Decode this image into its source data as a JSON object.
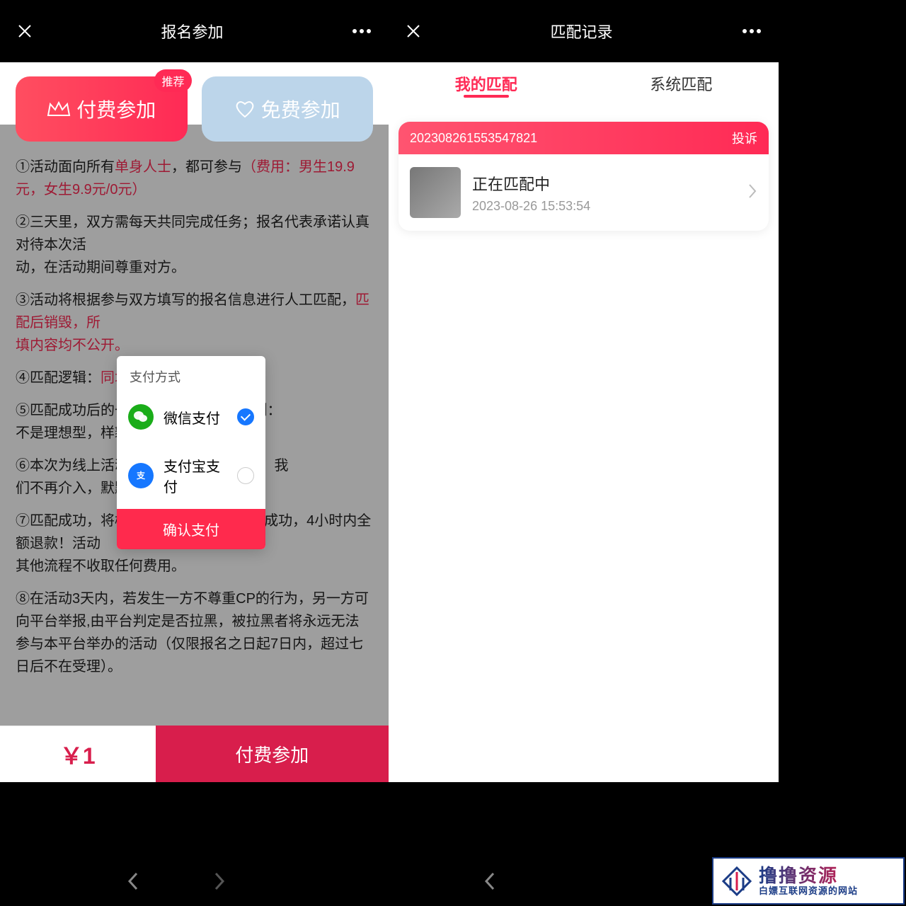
{
  "left": {
    "header_title": "报名参加",
    "paid_label": "付费参加",
    "free_label": "免费参加",
    "recommend_badge": "推荐",
    "rule1_a": "①活动面向所有",
    "rule1_b": "单身人士",
    "rule1_c": "，都可参与",
    "rule1_d": "（费用：男生19.9元，女生9.9元/0元）",
    "rule2": "②三天里，双方需每天共同完成任务；报名代表承诺认真对待本次活\n动，在活动期间尊重对方。",
    "rule3_a": "③活动将根据参与双方填写的报名信息进行人工匹配，",
    "rule3_b": "匹配后销毁，所\n填内容均不公开。",
    "rule4_a": "④匹配逻辑：",
    "rule4_b": "同城优",
    "rule4_c": "。",
    "rule5": "⑤匹配成功后的一律                                            误大意的理由。（例：\n不是理想型，样貌不",
    "rule6": "⑥本次为线上活动，                                            活动后请自行发展，我\n们不再介入，默默祝福。",
    "rule7": "⑦匹配成功，将概不退款；7天后匹配不成功，4小时内全额退款！活动\n其他流程不收取任何费用。",
    "rule8": "⑧在活动3天内，若发生一方不尊重CP的行为，另一方可向平台举报,由平台判定是否拉黑，被拉黑者将永远无法参与本平台举办的活动（仅限报名之日起7日内，超过七日后不在受理）。",
    "price": "￥1",
    "cta": "付费参加",
    "modal": {
      "title": "支付方式",
      "wechat": "微信支付",
      "alipay": "支付宝支付",
      "confirm": "确认支付"
    }
  },
  "right": {
    "header_title": "匹配记录",
    "tab_my": "我的匹配",
    "tab_sys": "系统匹配",
    "card": {
      "id": "202308261553547821",
      "report": "投诉",
      "status": "正在匹配中",
      "time": "2023-08-26 15:53:54"
    }
  },
  "badge": {
    "title": "撸撸资源",
    "sub": "白嫖互联网资源的网站"
  }
}
